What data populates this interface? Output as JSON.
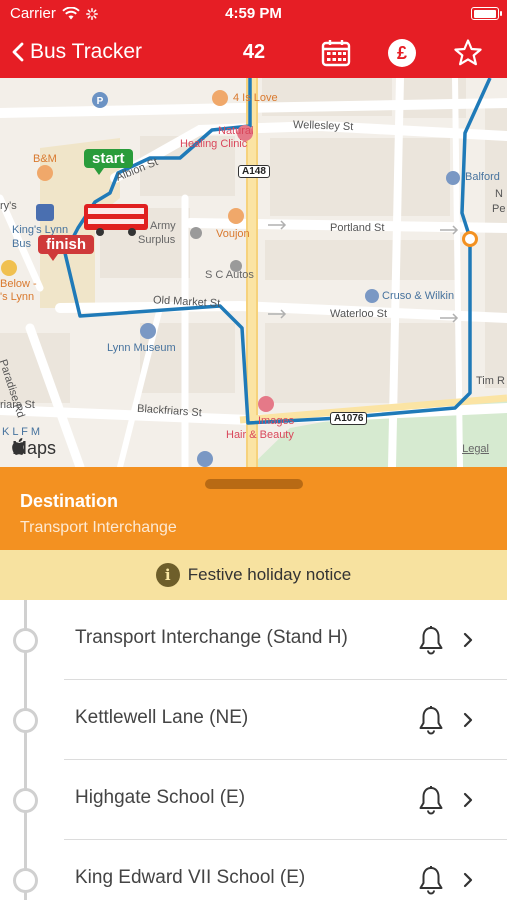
{
  "status_bar": {
    "carrier": "Carrier",
    "time": "4:59 PM",
    "battery_level": 1.0
  },
  "nav": {
    "back_label": "Bus Tracker",
    "route_number": "42",
    "icons": [
      "calendar-icon",
      "pound-icon",
      "star-icon"
    ]
  },
  "map": {
    "labels": {
      "four_is_love": "4 Is Love",
      "wellesley": "Wellesley St",
      "natural": "Natural",
      "healing": "Healing Clinic",
      "bm": "B&M",
      "albion": "Albion St",
      "a148": "A148",
      "balford": "Balford",
      "army1": "Army",
      "surplus": "Surplus",
      "voujon": "Voujon",
      "portland": "Portland St",
      "kings_lynn1": "King's Lynn",
      "kings_lynn2": "Bus",
      "rys": "ry's",
      "below1": "Below -",
      "below2": "'s Lynn",
      "sc_autos": "S C Autos",
      "old_market": "Old Market St",
      "cruso": "Cruso & Wilkin",
      "waterloo": "Waterloo St",
      "lynn_museum": "Lynn Museum",
      "paradise": "Paradise Rd",
      "tim": "Tim R",
      "pe": "Pe",
      "n": "N",
      "blackfriars": "Blackfriars St",
      "friars": "riars St",
      "images": "Images",
      "hair": "Hair & Beauty",
      "a1076": "A1076",
      "klfm": "K L F M",
      "legal": "Legal",
      "apple_maps": "Maps"
    },
    "pins": {
      "start": "start",
      "finish": "finish"
    }
  },
  "destination": {
    "title": "Destination",
    "subtitle": "Transport Interchange"
  },
  "notice": {
    "text": "Festive holiday notice"
  },
  "stops": [
    {
      "name": "Transport Interchange (Stand H)"
    },
    {
      "name": "Kettlewell Lane (NE)"
    },
    {
      "name": "Highgate School (E)"
    },
    {
      "name": "King Edward VII School (E)"
    }
  ],
  "colors": {
    "brand_red": "#e61e25",
    "destination_orange": "#f39121",
    "notice_yellow": "#f7e2a0",
    "route_blue": "#1f7ab8"
  }
}
